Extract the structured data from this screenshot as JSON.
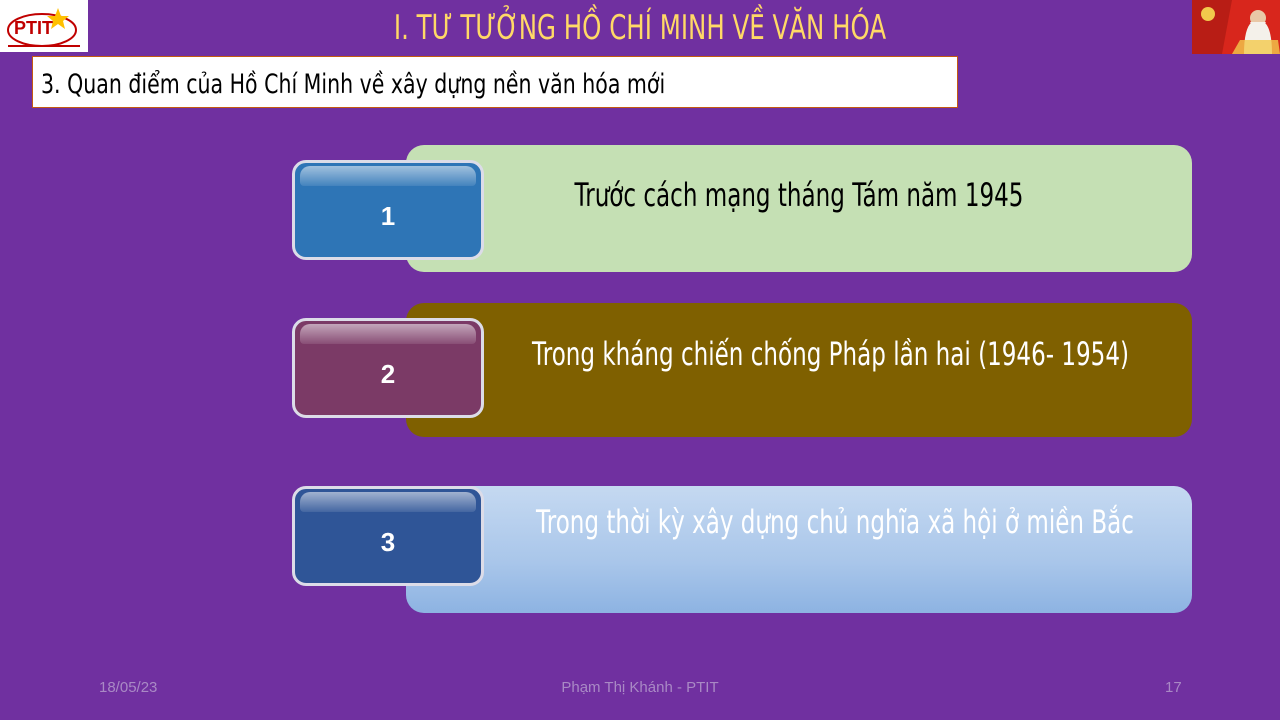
{
  "header": {
    "logo_text": "PTIT",
    "title": "I. TƯ TƯỞNG HỒ CHÍ MINH VỀ VĂN HÓA"
  },
  "subtitle": "3. Quan điểm của Hồ Chí Minh về xây dựng nền văn hóa mới",
  "items": [
    {
      "number": "1",
      "text": "Trước cách mạng tháng Tám năm 1945",
      "bar_color": "#c5e0b4",
      "text_color": "#000000",
      "box_color": "#2e75b6"
    },
    {
      "number": "2",
      "text": "Trong kháng chiến chống Pháp lần hai (1946- 1954)",
      "bar_color": "#7f6000",
      "text_color": "#ffffff",
      "box_color": "#7b3a66"
    },
    {
      "number": "3",
      "text": "Trong thời kỳ xây dựng chủ nghĩa xã hội ở miền Bắc",
      "bar_color": "#a9c6ea",
      "text_color": "#ffffff",
      "box_color": "#2f5597"
    }
  ],
  "footer": {
    "date": "18/05/23",
    "author": "Phạm Thị Khánh - PTIT",
    "page": "17"
  }
}
